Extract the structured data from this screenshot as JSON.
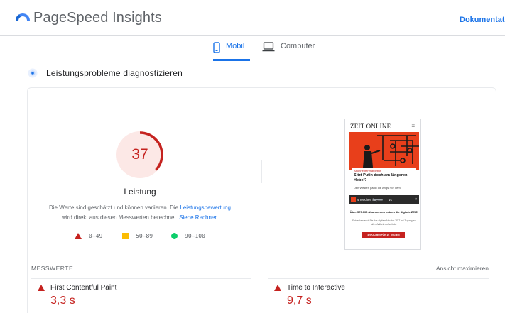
{
  "header": {
    "app_title": "PageSpeed Insights",
    "doc_link": "Dokumentatio"
  },
  "tabs": [
    {
      "label": "Mobil",
      "icon": "smartphone-icon",
      "active": true
    },
    {
      "label": "Computer",
      "icon": "laptop-icon",
      "active": false
    }
  ],
  "section": {
    "title": "Leistungsprobleme diagnostizieren"
  },
  "score": {
    "value": "37",
    "fraction": 0.37,
    "label": "Leistung",
    "color": "#c5221f",
    "note_line1": "Die Werte sind geschätzt und können variieren. Die ",
    "note_link1": "Leistungsbewertung",
    "note_line2": "wird direkt aus diesen Messwerten berechnet. ",
    "note_link2": "Siehe Rechner."
  },
  "legend": [
    {
      "range": "0–49",
      "shape": "triangle",
      "color": "#c5221f"
    },
    {
      "range": "50–89",
      "shape": "square",
      "color": "#fbbc04"
    },
    {
      "range": "90–100",
      "shape": "circle",
      "color": "#0cce6b"
    }
  ],
  "screenshot_preview": {
    "site_logo": "ZEIT ONLINE",
    "kicker": "Abonnentenmargebot",
    "headline": "Sitzt Putin doch am längeren Hebel?",
    "sub": "Den Westen packt die Angst vor dem",
    "promo_weeks": "4 Wochen für",
    "promo_old_price": "23,40€",
    "promo_new_price": "1€",
    "promo_close": "×",
    "offer_title": "Über 570.000 Abonnenten nutzen die digitale ZEIT.",
    "offer_text": "Entdecken auch Sie das digitale Abo der ZEIT mit Zugang zu allen Artikeln auf zeit.de.",
    "cta": "4 WOCHEN FÜR 1€ TESTEN"
  },
  "metrics": {
    "label": "MESSWERTE",
    "expand": "Ansicht maximieren",
    "items": [
      {
        "name": "First Contentful Paint",
        "value": "3,3 s",
        "status": "poor"
      },
      {
        "name": "Time to Interactive",
        "value": "9,7 s",
        "status": "poor"
      }
    ]
  },
  "colors": {
    "accent": "#1a73e8",
    "poor": "#c5221f",
    "average": "#fbbc04",
    "good": "#0cce6b"
  }
}
